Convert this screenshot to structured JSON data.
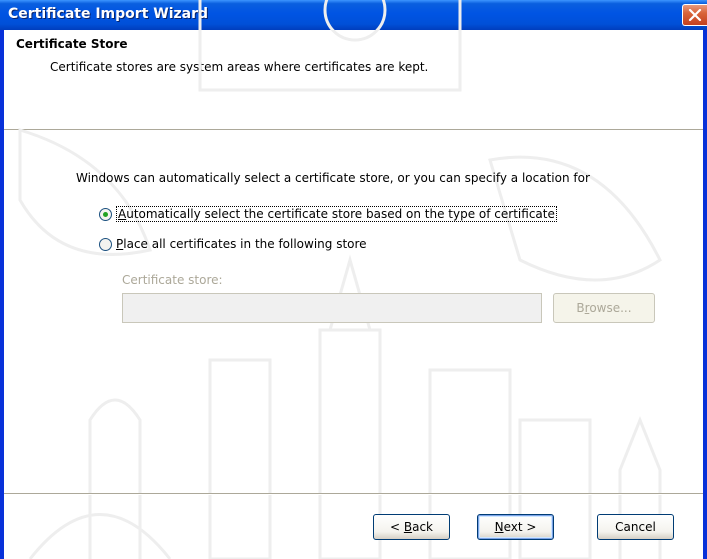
{
  "window": {
    "title": "Certificate Import Wizard"
  },
  "header": {
    "title": "Certificate Store",
    "subtitle": "Certificate stores are system areas where certificates are kept."
  },
  "body": {
    "intro": "Windows can automatically select a certificate store, or you can specify a location for",
    "option_auto": {
      "label_pre": "",
      "label_mnemonic": "A",
      "label_post": "utomatically select the certificate store based on the type of certificate",
      "checked": true
    },
    "option_manual": {
      "label_pre": "",
      "label_mnemonic": "P",
      "label_post": "lace all certificates in the following store",
      "checked": false
    },
    "store_label": "Certificate store:",
    "store_value": "",
    "browse_pre": "B",
    "browse_mnemonic": "r",
    "browse_post": "owse..."
  },
  "footer": {
    "back_pre": "< ",
    "back_mnemonic": "B",
    "back_post": "ack",
    "next_mnemonic": "N",
    "next_post": "ext >",
    "cancel_label": "Cancel"
  },
  "colors": {
    "titlebar": "#0054e3",
    "close_button": "#d9643a",
    "radio_dot": "#21a121",
    "disabled_text": "#aca899"
  }
}
